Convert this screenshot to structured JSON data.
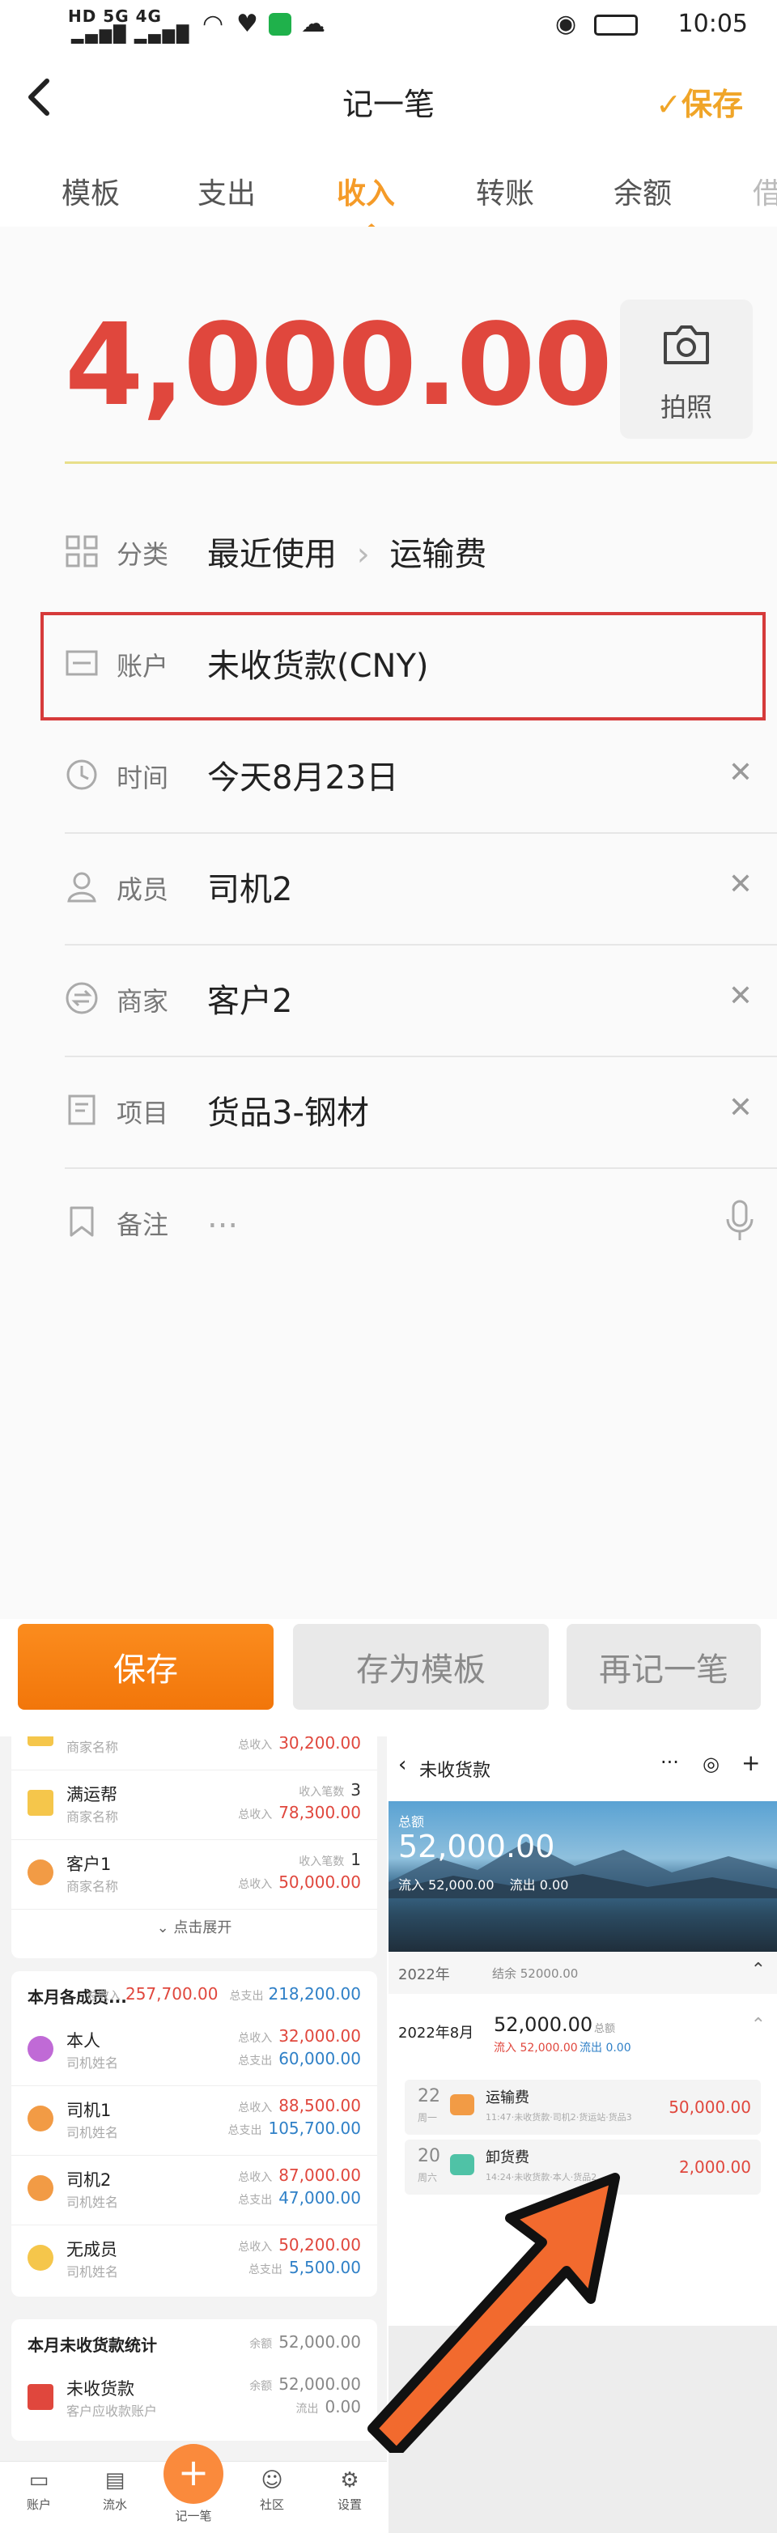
{
  "status_bar": {
    "signal_text": "HD 5G 4G",
    "time": "10:05"
  },
  "nav": {
    "title": "记一笔",
    "save": "✓保存"
  },
  "tabs": [
    "模板",
    "支出",
    "收入",
    "转账",
    "余额",
    "借"
  ],
  "form": {
    "amount": "4,000.00",
    "photo_label": "拍照",
    "category": {
      "label": "分类",
      "value": "最近使用",
      "value2": "运输费"
    },
    "account": {
      "label": "账户",
      "value": "未收货款(CNY)"
    },
    "time": {
      "label": "时间",
      "value": "今天8月23日"
    },
    "member": {
      "label": "成员",
      "value": "司机2"
    },
    "merchant": {
      "label": "商家",
      "value": "客户2"
    },
    "project": {
      "label": "项目",
      "value": "货品3-钢材"
    },
    "note": {
      "label": "备注",
      "placeholder": "..."
    }
  },
  "buttons": {
    "save": "保存",
    "save_template": "存为模板",
    "again": "再记一笔"
  },
  "left_panel": {
    "merchants": [
      {
        "name": "",
        "sub": "商家名称",
        "k1": "",
        "v1": "",
        "k2": "总收入",
        "v2": "30,200.00"
      },
      {
        "name": "满运帮",
        "sub": "商家名称",
        "k1": "收入笔数",
        "v1": "3",
        "k2": "总收入",
        "v2": "78,300.00"
      },
      {
        "name": "客户1",
        "sub": "商家名称",
        "k1": "收入笔数",
        "v1": "1",
        "k2": "总收入",
        "v2": "50,000.00"
      }
    ],
    "expand": "点击展开",
    "members_title": "本月各成员...",
    "members_k1": "总收入",
    "members_income": "257,700.00",
    "members_k2": "总支出",
    "members_expense": "218,200.00",
    "members": [
      {
        "name": "本人",
        "sub": "司机姓名",
        "k1": "总收入",
        "v1": "32,000.00",
        "k2": "总支出",
        "v2": "60,000.00"
      },
      {
        "name": "司机1",
        "sub": "司机姓名",
        "k1": "总收入",
        "v1": "88,500.00",
        "k2": "总支出",
        "v2": "105,700.00"
      },
      {
        "name": "司机2",
        "sub": "司机姓名",
        "k1": "总收入",
        "v1": "87,000.00",
        "k2": "总支出",
        "v2": "47,000.00"
      },
      {
        "name": "无成员",
        "sub": "司机姓名",
        "k1": "总收入",
        "v1": "50,200.00",
        "k2": "总支出",
        "v2": "5,500.00"
      }
    ],
    "receivable_title": "本月未收货款统计",
    "receivable_k": "余额",
    "receivable_total": "52,000.00",
    "receivable": {
      "name": "未收货款",
      "sub": "客户应收款账户",
      "k1": "余额",
      "v1": "52,000.00",
      "k2": "流出",
      "v2": "0.00"
    },
    "tabbar": [
      "账户",
      "流水",
      "记一笔",
      "社区",
      "设置"
    ]
  },
  "right_panel": {
    "title": "未收货款",
    "banner_label": "总额",
    "banner_amount": "52,000.00",
    "inflow_label": "流入",
    "inflow": "52,000.00",
    "outflow_label": "流出",
    "outflow": "0.00",
    "year": "2022年",
    "year_balance": "结余 52000.00",
    "month": "2022年8月",
    "month_amount": "52,000.00",
    "month_amount_label": "总额",
    "month_in": "流入 52,000.00",
    "month_out": "流出 0.00",
    "entries": [
      {
        "day": "22",
        "weekday": "周一",
        "title": "运输费",
        "detail": "11:47·未收货款·司机2·货运站·货品3",
        "amount": "50,000.00"
      },
      {
        "day": "20",
        "weekday": "周六",
        "title": "卸货费",
        "detail": "14:24·未收货款·本人·货品2",
        "amount": "2,000.00"
      }
    ]
  },
  "colors": {
    "accent": "#f59b28",
    "amount_red": "#e0473d",
    "highlight_border": "#d63a3a",
    "arrow": "#f26a2e"
  }
}
